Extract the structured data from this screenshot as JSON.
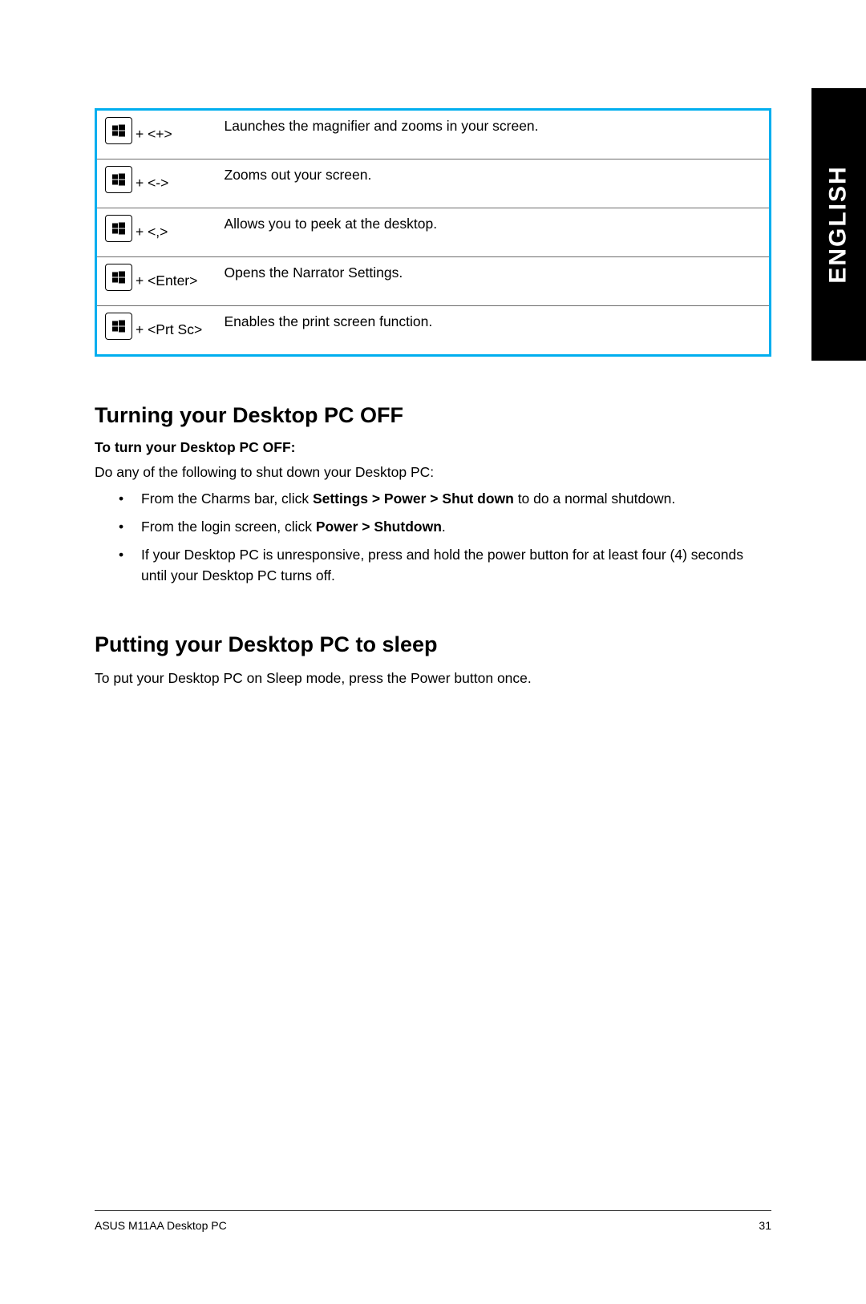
{
  "language_tab": "ENGLISH",
  "shortcuts": [
    {
      "combo": "+ <+>",
      "desc": "Launches the magnifier and zooms in your screen."
    },
    {
      "combo": "+ <->",
      "desc": "Zooms out your screen."
    },
    {
      "combo": "+ <,>",
      "desc": "Allows you to peek at the desktop."
    },
    {
      "combo": "+ <Enter>",
      "desc": "Opens the Narrator Settings."
    },
    {
      "combo": "+ <Prt Sc>",
      "desc": "Enables the print screen function."
    }
  ],
  "section_off": {
    "heading": "Turning your Desktop PC OFF",
    "subhead": "To turn your Desktop PC OFF:",
    "intro": "Do any of the following to shut down your Desktop PC:",
    "bullets": [
      {
        "pre": "From the Charms bar, click ",
        "bold": "Settings > Power > Shut down",
        "post": " to do a normal shutdown."
      },
      {
        "pre": "From the login screen, click ",
        "bold": "Power > Shutdown",
        "post": "."
      },
      {
        "pre": "If your Desktop PC is unresponsive, press and hold the power  button for at least four (4) seconds until your Desktop PC turns off.",
        "bold": "",
        "post": ""
      }
    ]
  },
  "section_sleep": {
    "heading": "Putting your Desktop PC to sleep",
    "body": "To put your Desktop PC on Sleep mode, press the Power button once."
  },
  "footer": {
    "product": "ASUS M11AA Desktop PC",
    "page": "31"
  }
}
